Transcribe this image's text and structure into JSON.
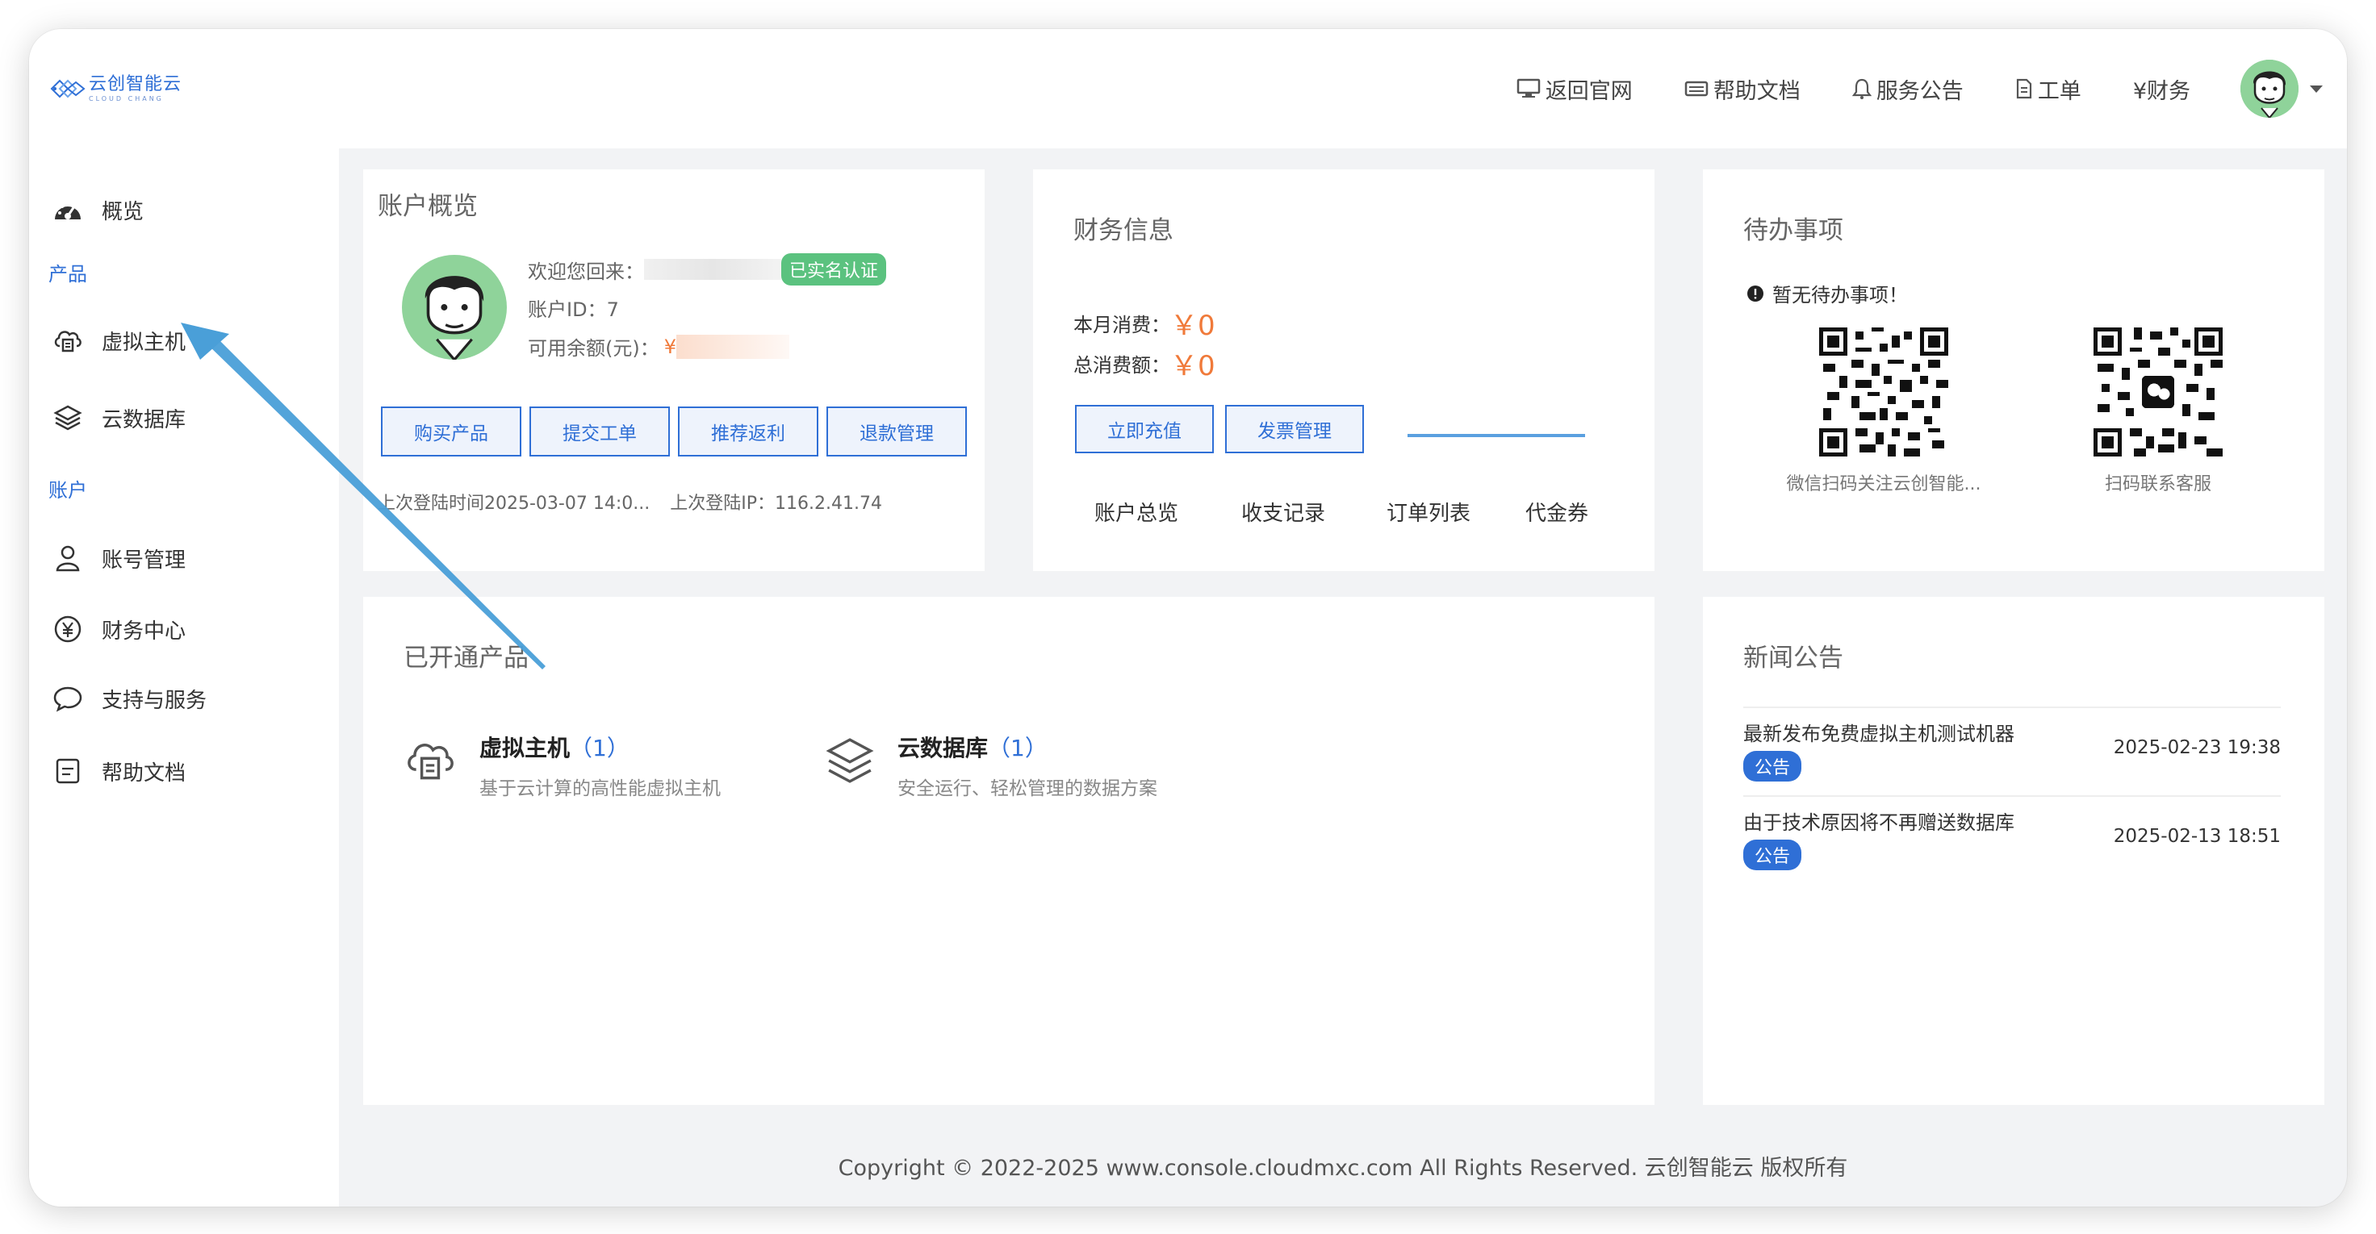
{
  "brand": {
    "name_cn": "云创智能云",
    "name_en": "CLOUD CHANG"
  },
  "topnav": [
    {
      "label": "返回官网",
      "icon": "monitor-icon"
    },
    {
      "label": "帮助文档",
      "icon": "keyboard-icon"
    },
    {
      "label": "服务公告",
      "icon": "bell-icon"
    },
    {
      "label": "工单",
      "icon": "file-icon"
    },
    {
      "label": "¥财务",
      "icon": "yen-text"
    }
  ],
  "sidebar": {
    "overview": "概览",
    "group_products": "产品",
    "vhost": "虚拟主机",
    "clouddb": "云数据库",
    "group_account": "账户",
    "account": "账号管理",
    "finance": "财务中心",
    "support": "支持与服务",
    "help": "帮助文档"
  },
  "account_card": {
    "title": "账户概览",
    "welcome": "欢迎您回来：",
    "verified_badge": "已实名认证",
    "id_label": "账户ID：",
    "id_value": "7",
    "balance_label": "可用余额(元)：",
    "balance_value": "¥",
    "buttons": [
      "购买产品",
      "提交工单",
      "推荐返利",
      "退款管理"
    ],
    "last_login_time": "上次登陆时间2025-03-07 14:0...",
    "last_login_ip_label": "上次登陆IP：",
    "last_login_ip": "116.2.41.74"
  },
  "finance_card": {
    "title": "财务信息",
    "month_label": "本月消费：",
    "month_value": "￥0",
    "total_label": "总消费额：",
    "total_value": "￥0",
    "buttons": [
      "立即充值",
      "发票管理"
    ],
    "tabs": [
      "账户总览",
      "收支记录",
      "订单列表",
      "代金券"
    ]
  },
  "todo_card": {
    "title": "待办事项",
    "empty": "暂无待办事项！",
    "qr1_caption": "微信扫码关注云创智能...",
    "qr2_caption": "扫码联系客服"
  },
  "products_card": {
    "title": "已开通产品",
    "items": [
      {
        "name": "虚拟主机",
        "count": "（1）",
        "desc": "基于云计算的高性能虚拟主机"
      },
      {
        "name": "云数据库",
        "count": "（1）",
        "desc": "安全运行、轻松管理的数据方案"
      }
    ]
  },
  "news_card": {
    "title": "新闻公告",
    "items": [
      {
        "title": "最新发布免费虚拟主机测试机器",
        "tag": "公告",
        "date": "2025-02-23 19:38"
      },
      {
        "title": "由于技术原因将不再赠送数据库",
        "tag": "公告",
        "date": "2025-02-13 18:51"
      }
    ]
  },
  "footer": "Copyright © 2022-2025 www.console.cloudmxc.com All Rights Reserved. 云创智能云 版权所有",
  "colors": {
    "accent": "#2f6fd6",
    "green": "#5bc27f",
    "orange": "#f07a3a",
    "annotation": "#4a9fd8"
  }
}
